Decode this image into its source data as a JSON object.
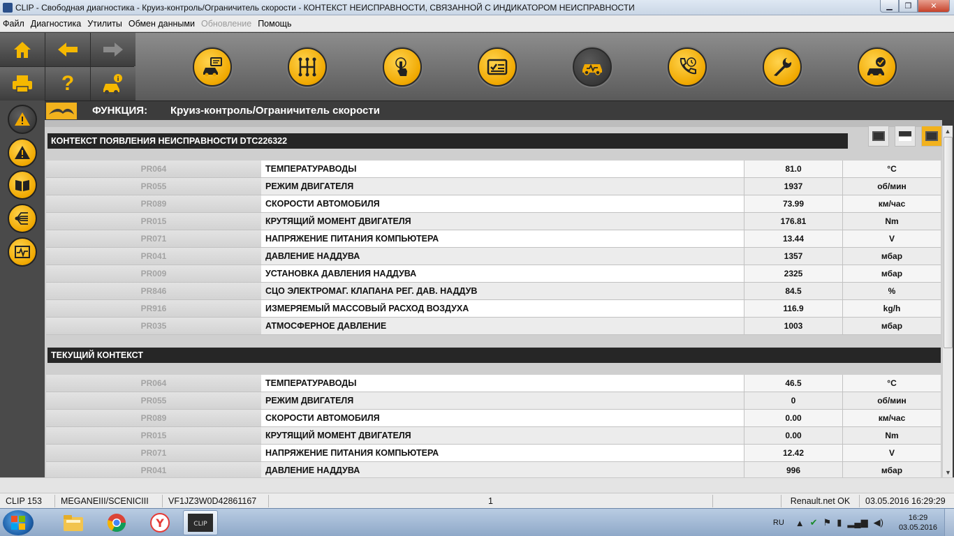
{
  "window": {
    "title": "CLIP - Свободная диагностика - Круиз-контроль/Ограничитель скорости - КОНТЕКСТ НЕИСПРАВНОСТИ, СВЯЗАННОЙ С ИНДИКАТОРОМ НЕИСПРАВНОСТИ",
    "minimize": "▁",
    "maximize": "❐",
    "close": "✕"
  },
  "menu": {
    "file": "Файл",
    "diagnostics": "Диагностика",
    "utilities": "Утилиты",
    "data_exchange": "Обмен данными",
    "update": "Обновление",
    "help": "Помощь"
  },
  "toolbar": {
    "nav_icons": [
      "home-icon",
      "back-arrow-icon",
      "forward-arrow-icon",
      "print-icon",
      "help-icon",
      "vehicle-info-icon"
    ],
    "help_label": "?",
    "function_icons": [
      "vehicle-screen-icon",
      "gearbox-icon",
      "touch-icon",
      "checklist-icon",
      "vehicle-diagnostic-icon",
      "phone-support-icon",
      "wrench-icon",
      "vehicle-check-icon"
    ]
  },
  "sidebar": {
    "icons": [
      "warning-active-icon",
      "warning-icon",
      "manual-book-icon",
      "network-icon",
      "oscilloscope-icon"
    ]
  },
  "function_bar": {
    "label": "ФУНКЦИЯ:",
    "value": "Круиз-контроль/Ограничитель скорости"
  },
  "section_fault": {
    "title": "КОНТЕКСТ ПОЯВЛЕНИЯ НЕИСПРАВНОСТИ DTC226322",
    "rows": [
      {
        "code": "PR064",
        "name": "ТЕМПЕРАТУРАВОДЫ",
        "value": "81.0",
        "unit": "°C"
      },
      {
        "code": "PR055",
        "name": "РЕЖИМ ДВИГАТЕЛЯ",
        "value": "1937",
        "unit": "об/мин"
      },
      {
        "code": "PR089",
        "name": "СКОРОСТИ АВТОМОБИЛЯ",
        "value": "73.99",
        "unit": "км/час"
      },
      {
        "code": "PR015",
        "name": "КРУТЯЩИЙ МОМЕНТ ДВИГАТЕЛЯ",
        "value": "176.81",
        "unit": "Nm"
      },
      {
        "code": "PR071",
        "name": "НАПРЯЖЕНИЕ ПИТАНИЯ КОМПЬЮТЕРА",
        "value": "13.44",
        "unit": "V"
      },
      {
        "code": "PR041",
        "name": "ДАВЛЕНИЕ НАДДУВА",
        "value": "1357",
        "unit": "мбар"
      },
      {
        "code": "PR009",
        "name": "УСТАНОВКА ДАВЛЕНИЯ НАДДУВА",
        "value": "2325",
        "unit": "мбар"
      },
      {
        "code": "PR846",
        "name": "СЦО ЭЛЕКТРОМАГ. КЛАПАНА РЕГ. ДАВ. НАДДУВ",
        "value": "84.5",
        "unit": "%"
      },
      {
        "code": "PR916",
        "name": "ИЗМЕРЯЕМЫЙ МАССОВЫЙ РАСХОД ВОЗДУХА",
        "value": "116.9",
        "unit": "kg/h"
      },
      {
        "code": "PR035",
        "name": "АТМОСФЕРНОЕ ДАВЛЕНИЕ",
        "value": "1003",
        "unit": "мбар"
      }
    ]
  },
  "section_current": {
    "title": "ТЕКУЩИЙ КОНТЕКСТ",
    "rows": [
      {
        "code": "PR064",
        "name": "ТЕМПЕРАТУРАВОДЫ",
        "value": "46.5",
        "unit": "°C"
      },
      {
        "code": "PR055",
        "name": "РЕЖИМ ДВИГАТЕЛЯ",
        "value": "0",
        "unit": "об/мин"
      },
      {
        "code": "PR089",
        "name": "СКОРОСТИ АВТОМОБИЛЯ",
        "value": "0.00",
        "unit": "км/час"
      },
      {
        "code": "PR015",
        "name": "КРУТЯЩИЙ МОМЕНТ ДВИГАТЕЛЯ",
        "value": "0.00",
        "unit": "Nm"
      },
      {
        "code": "PR071",
        "name": "НАПРЯЖЕНИЕ ПИТАНИЯ КОМПЬЮТЕРА",
        "value": "12.42",
        "unit": "V"
      },
      {
        "code": "PR041",
        "name": "ДАВЛЕНИЕ НАДДУВА",
        "value": "996",
        "unit": "мбар"
      }
    ]
  },
  "statusbar": {
    "clip": "CLIP 153",
    "vehicle": "MEGANEIII/SCENICIII",
    "vin": "VF1JZ3W0D42861167",
    "page": "1",
    "network": "Renault.net OK",
    "datetime": "03.05.2016 16:29:29"
  },
  "taskbar": {
    "apps": [
      "explorer-icon",
      "chrome-icon",
      "yandex-browser-icon",
      "clip-app-icon"
    ],
    "yandex_label": "Y",
    "clip_label": "CLIP",
    "language": "RU",
    "time": "16:29",
    "date": "03.05.2016"
  },
  "colors": {
    "accent": "#f2b21d",
    "dark_header": "#262626"
  }
}
